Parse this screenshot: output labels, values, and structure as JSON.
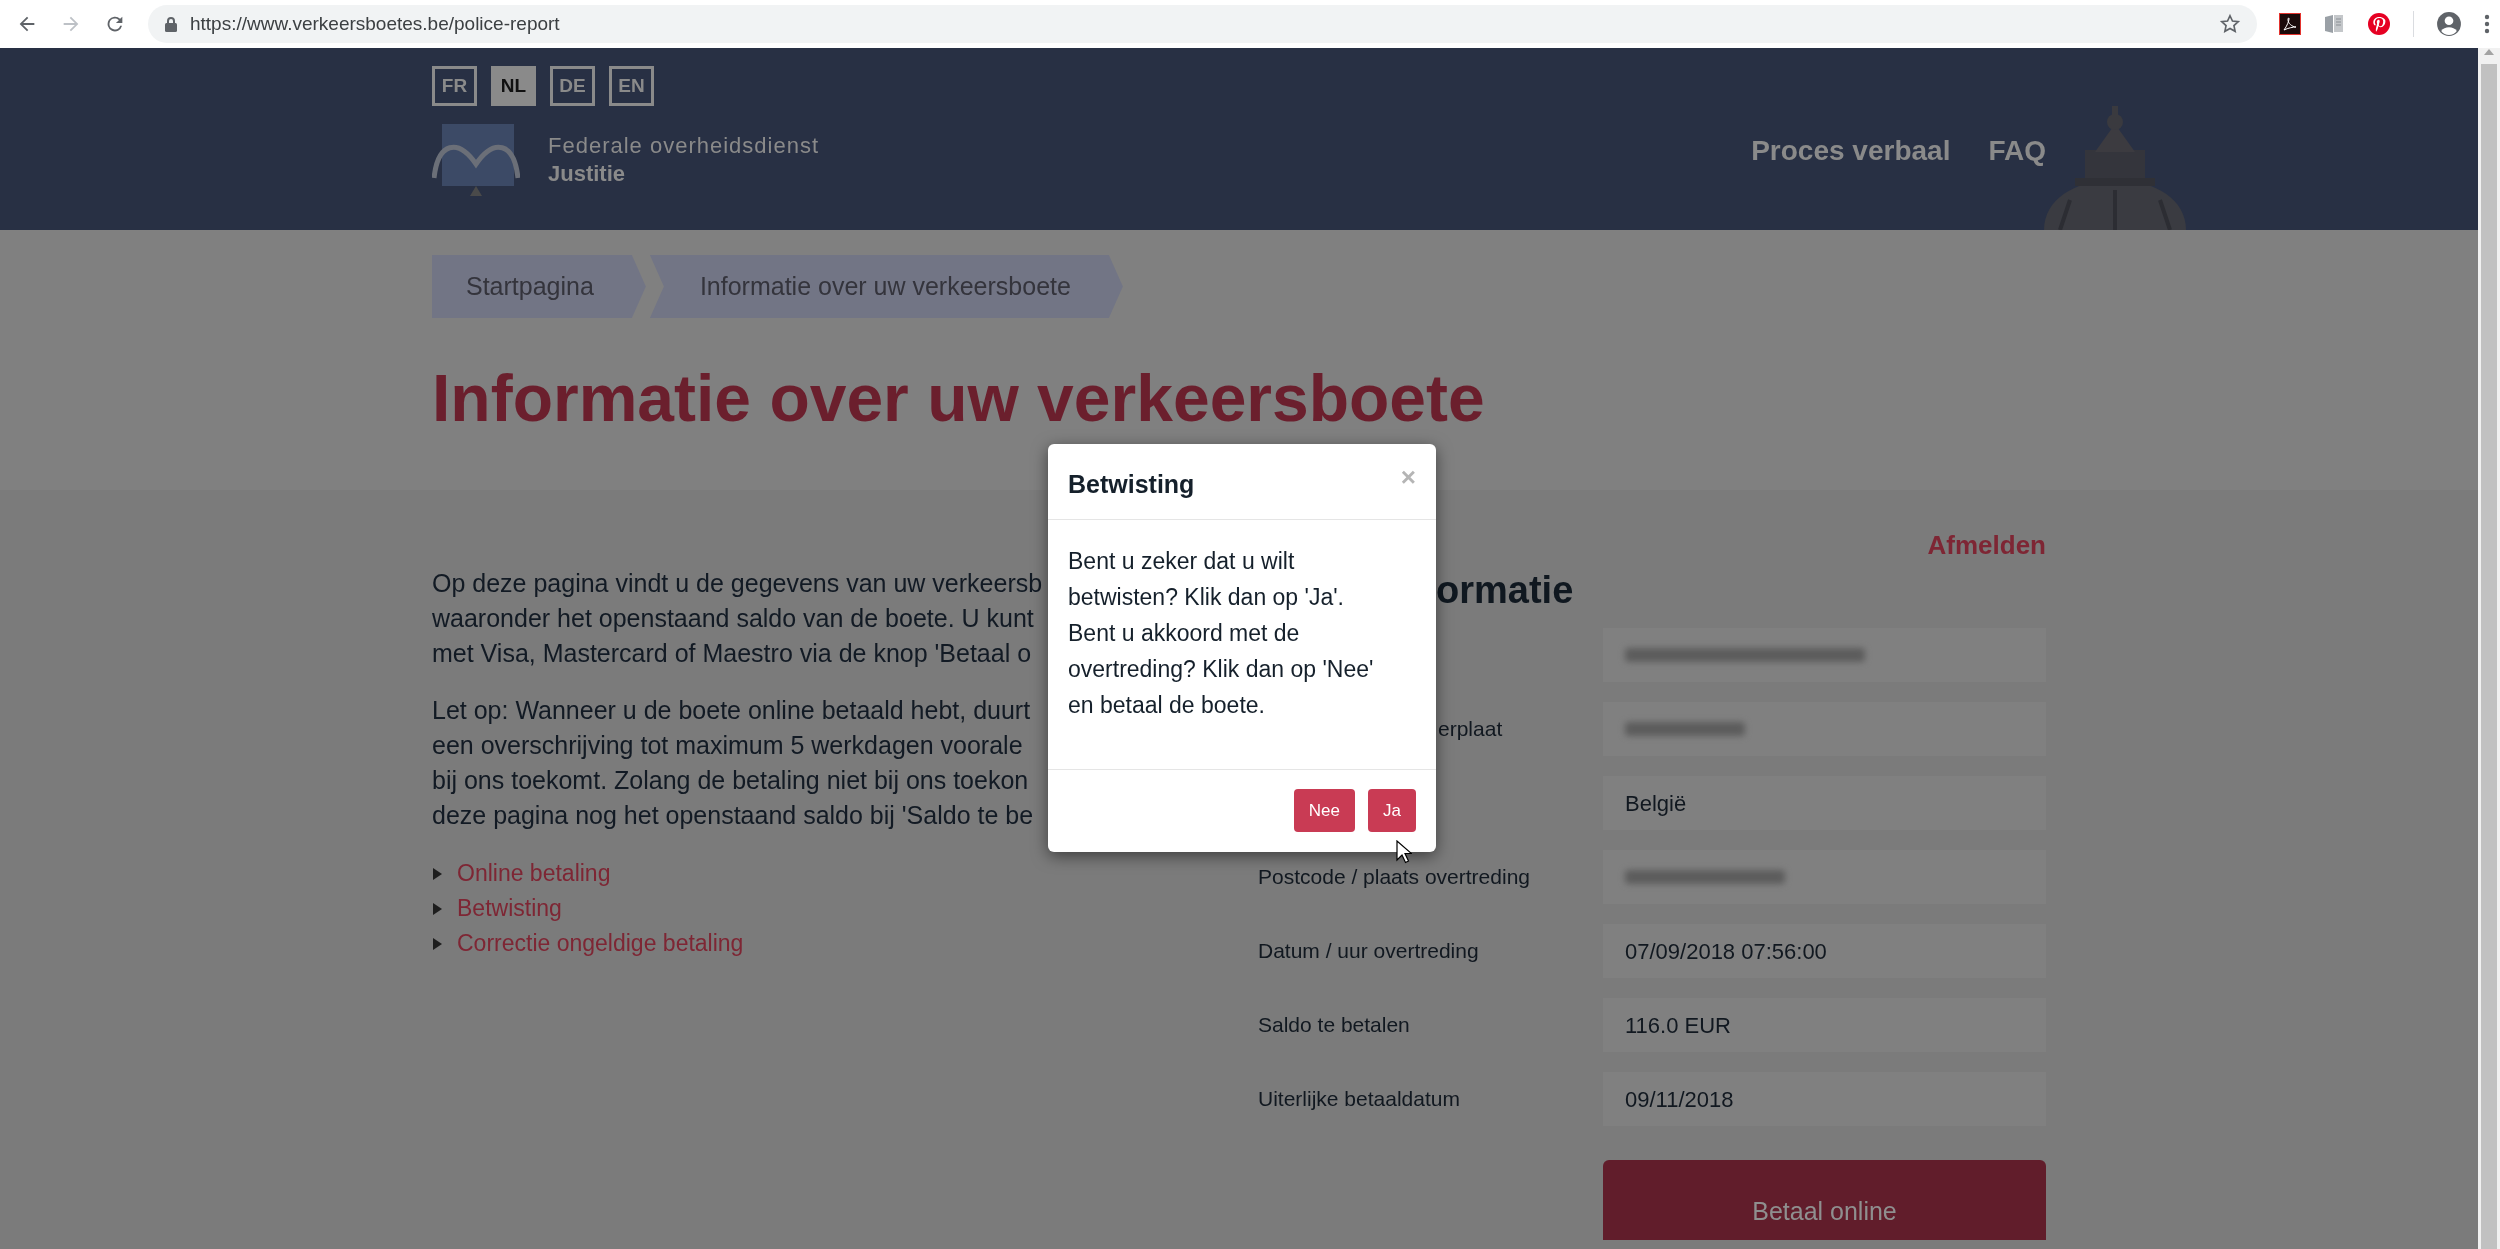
{
  "browser": {
    "url": "https://www.verkeersboetes.be/police-report"
  },
  "languages": [
    {
      "label": "FR",
      "selected": false
    },
    {
      "label": "NL",
      "selected": true
    },
    {
      "label": "DE",
      "selected": false
    },
    {
      "label": "EN",
      "selected": false
    }
  ],
  "logo": {
    "line1": "Federale overheidsdienst",
    "line2": "Justitie"
  },
  "nav": [
    "Proces verbaal",
    "FAQ"
  ],
  "breadcrumb": [
    "Startpagina",
    "Informatie over uw verkeersboete"
  ],
  "title": "Informatie over uw verkeersboete",
  "intro_paragraphs": [
    {
      "lines": [
        "Op deze pagina vindt u de gegevens van uw verkeersb",
        "waaronder het openstaand saldo van de boete. U kunt",
        "met Visa, Mastercard of Maestro via de knop 'Betaal o"
      ]
    },
    {
      "lines": [
        "Let op: Wanneer u de boete online betaald hebt, duurt",
        "een overschrijving tot maximum 5 werkdagen voorale",
        "bij ons toekomt. Zolang de betaling niet bij ons toekon",
        "deze pagina nog het openstaand saldo bij 'Saldo te be"
      ]
    }
  ],
  "links": [
    {
      "label": "Online betaling",
      "expanded": false
    },
    {
      "label": "Betwisting",
      "expanded": false
    },
    {
      "label": "Correctie ongeldige betaling",
      "expanded": false
    }
  ],
  "logout": "Afmelden",
  "info_heading": "ormatie",
  "fields": [
    {
      "kind": "redacted"
    },
    {
      "kind": "redacted",
      "label": "erplaat"
    },
    {
      "kind": "text",
      "value": "België"
    },
    {
      "kind": "redacted",
      "label": "Postcode / plaats overtreding"
    },
    {
      "kind": "text",
      "label": "Datum / uur overtreding",
      "value": "07/09/2018 07:56:00"
    },
    {
      "kind": "text",
      "label": "Saldo te betalen",
      "value": "116.0 EUR"
    },
    {
      "kind": "text",
      "label": "Uiterlijke betaaldatum",
      "value": "09/11/2018"
    }
  ],
  "pay_button": "Betaal online",
  "modal": {
    "title": "Betwisting",
    "close": "×",
    "lines": [
      "Bent u zeker dat u wilt",
      "betwisten? Klik dan op 'Ja'.",
      "Bent u akkoord met de",
      "overtreding? Klik dan op 'Nee'",
      "en betaal de boete."
    ],
    "buttons": [
      "Nee",
      "Ja"
    ]
  }
}
